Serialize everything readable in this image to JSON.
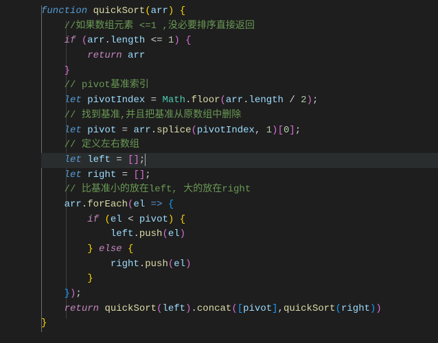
{
  "code": {
    "l1": {
      "fn": "function",
      "name": "quickSort",
      "param": "arr"
    },
    "l2": {
      "comment": "//如果数组元素 <=1 ,没必要排序直接返回"
    },
    "l3": {
      "if": "if",
      "arr": "arr",
      "len": "length",
      "op": "<=",
      "num": "1"
    },
    "l4": {
      "ret": "return",
      "arr": "arr"
    },
    "l6": {
      "comment": "// pivot基准索引"
    },
    "l7": {
      "let": "let",
      "pivotIndex": "pivotIndex",
      "Math": "Math",
      "floor": "floor",
      "arr": "arr",
      "len": "length",
      "two": "2"
    },
    "l8": {
      "comment": "// 找到基准,并且把基准从原数组中删除"
    },
    "l9": {
      "let": "let",
      "pivot": "pivot",
      "arr": "arr",
      "splice": "splice",
      "pIdx": "pivotIndex",
      "one": "1",
      "zero": "0"
    },
    "l10": {
      "comment": "// 定义左右数组"
    },
    "l11": {
      "let": "let",
      "left": "left"
    },
    "l12": {
      "let": "let",
      "right": "right"
    },
    "l13": {
      "comment": "// 比基准小的放在left, 大的放在right"
    },
    "l14": {
      "arr": "arr",
      "forEach": "forEach",
      "el": "el"
    },
    "l15": {
      "if": "if",
      "el": "el",
      "pivot": "pivot"
    },
    "l16": {
      "left": "left",
      "push": "push",
      "el": "el"
    },
    "l17": {
      "else": "else"
    },
    "l18": {
      "right": "right",
      "push": "push",
      "el": "el"
    },
    "l21": {
      "ret": "return",
      "qs": "quickSort",
      "left": "left",
      "concat": "concat",
      "pivot": "pivot",
      "right": "right"
    }
  }
}
